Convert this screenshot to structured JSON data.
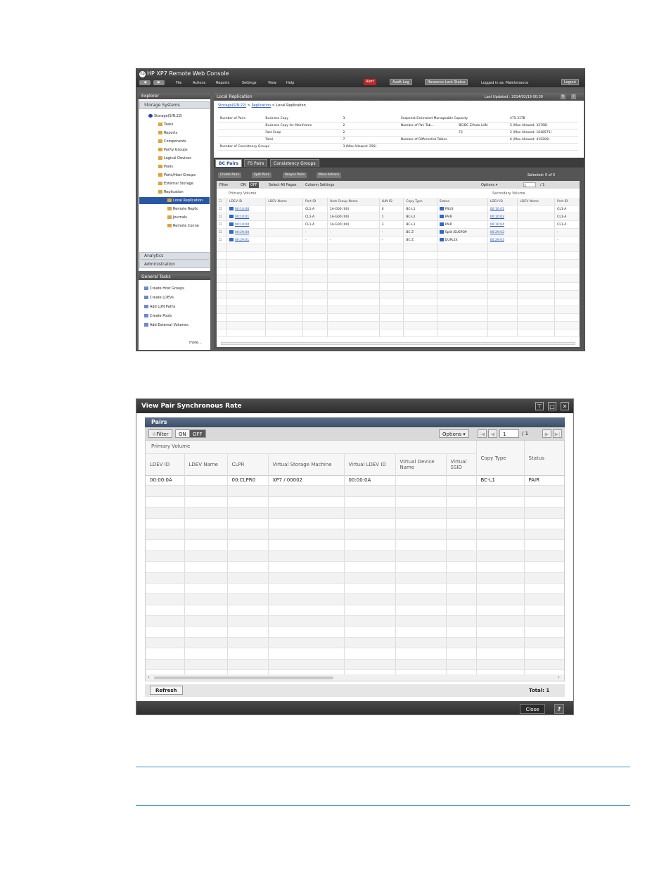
{
  "screen1": {
    "app_title": "HP XP7 Remote Web Console",
    "nav": {
      "back": "◀",
      "forward": "▶"
    },
    "menu": [
      "File",
      "Actions",
      "Reports",
      "Settings",
      "View",
      "Help"
    ],
    "alert": "Alert",
    "audit_log": "Audit Log",
    "resource_lock": "Resource Lock Status",
    "logged_in": "Logged in as: Maintenance",
    "logout": "Logout",
    "explorer": "Explorer",
    "storage_systems": "Storage Systems",
    "tree": [
      "Storage(S/N:22)",
      "Tasks",
      "Reports",
      "Components",
      "Parity Groups",
      "Logical Devices",
      "Pools",
      "Ports/Host Groups",
      "External Storage",
      "Replication",
      "Local Replication",
      "Remote Replic",
      "Journals",
      "Remote Conne"
    ],
    "analytics": "Analytics",
    "administration": "Administration",
    "general_tasks": "General Tasks",
    "tasks": [
      "Create Host Groups",
      "Create LDEVs",
      "Add LUN Paths",
      "Create Pools",
      "Add External Volumes"
    ],
    "more": "more...",
    "panel_title": "Local Replication",
    "last_updated": "Last Updated : 2014/02/19 00:30",
    "breadcrumb": {
      "storage": "Storage(S/N:22)",
      "sep1": ">",
      "replication": "Replication",
      "rest": "> Local Replication"
    },
    "summary": {
      "number_of_pairs": "Number of Pairs",
      "business_copy": "Business Copy",
      "business_copy_val": "3",
      "bc_mainframe": "Business Copy for Mainframe",
      "bc_mainframe_val": "2",
      "fast_snap": "Fast Snap",
      "fast_snap_val": "2",
      "total": "Total",
      "total_val": "7",
      "consistency_groups": "Number of Consistency Groups",
      "consistency_groups_val": "3 (Max Allowed: 256)",
      "snapshot_capacity": "Snapshot Estimated Manageable Capacity",
      "snapshot_capacity_val": "475.31TB",
      "pair_tables": "Number of Pair Tab...",
      "bc_auto_lun": "BC/BC Z/Auto LUN",
      "bc_auto_lun_val": "5 (Max Allowed: 32768)",
      "fs": "FS",
      "fs_val": "2 (Max Allowed: 1048575)",
      "diff_tables": "Number of Differential Tables",
      "diff_tables_val": "6 (Max Allowed: 419200)"
    },
    "tabs": [
      "BC Pairs",
      "FS Pairs",
      "Consistency Groups"
    ],
    "actions": [
      "Create Pairs",
      "Split Pairs",
      "Resync Pairs",
      "More Actions"
    ],
    "selected": "Selected: 0 of 5",
    "filter": "Filter",
    "on": "ON",
    "off": "OFF",
    "select_all": "Select All Pages",
    "column_settings": "Column Settings",
    "options": "Options ▾",
    "page": "1",
    "page_of": "/ 1",
    "primary_volume": "Primary Volume",
    "secondary_volume": "Secondary Volume",
    "columns": [
      "LDEV ID",
      "LDEV Name",
      "Port ID",
      "Host Group Name",
      "LUN ID",
      "Copy Type",
      "Status",
      "LDEV ID",
      "LDEV Name",
      "Port ID"
    ],
    "rows": [
      [
        "00:10:00",
        "",
        "CL1-A",
        "1A-G00 (00)",
        "0",
        "BC-L1",
        "PSUS",
        "00:10:01",
        "",
        "CL1-A"
      ],
      [
        "00:10:01",
        "",
        "CL1-A",
        "1A-G00 (00)",
        "1",
        "BC-L2",
        "PAIR",
        "00:10:02",
        "",
        "CL1-A"
      ],
      [
        "00:10:00",
        "",
        "CL1-A",
        "1A-G00 (00)",
        "3",
        "BC-L1",
        "PAIR",
        "00:10:04",
        "",
        "CL1-A"
      ],
      [
        "00:29:00",
        "",
        "-",
        "-",
        "-",
        "BC Z",
        "Split /SUSPOP",
        "00:29:02",
        "",
        "-"
      ],
      [
        "00:29:01",
        "",
        "-",
        "-",
        "-",
        "BC Z",
        "DUPLEX",
        "00:29:03",
        "",
        "-"
      ]
    ]
  },
  "screen2": {
    "title": "View Pair Synchronous Rate",
    "pairs": "Pairs",
    "filter": "Filter",
    "on": "ON",
    "off": "OFF",
    "options": "Options ▾",
    "page": "1",
    "page_of": "/ 1",
    "primary_volume": "Primary Volume",
    "columns": [
      "LDEV ID",
      "LDEV Name",
      "CLPR",
      "Virtual Storage Machine",
      "Virtual LDEV ID",
      "Virtual Device Name",
      "Virtual SSID",
      "Copy Type",
      "Status"
    ],
    "rows": [
      [
        "00:00:0A",
        "",
        "00:CLPR0",
        "XP7 / 00002",
        "00:00:0A",
        "",
        "",
        "BC-L1",
        "PAIR"
      ]
    ],
    "refresh": "Refresh",
    "total": "Total:  1",
    "close": "Close",
    "help": "?"
  }
}
